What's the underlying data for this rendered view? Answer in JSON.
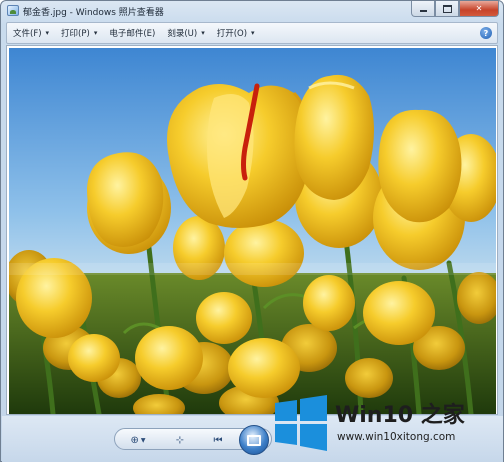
{
  "window": {
    "title": "郁金香.jpg - Windows 照片查看器"
  },
  "menubar": {
    "items": [
      {
        "label": "文件(F)",
        "caret": "▾"
      },
      {
        "label": "打印(P)",
        "caret": "▾"
      },
      {
        "label": "电子邮件(E)",
        "caret": ""
      },
      {
        "label": "刻录(U)",
        "caret": "▾"
      },
      {
        "label": "打开(O)",
        "caret": "▾"
      }
    ],
    "help_glyph": "?"
  },
  "photo": {
    "subject": "yellow tulips against a blue sky"
  },
  "controls": {
    "zoom_icon": "magnifier-icon",
    "fit_icon": "fit-window-icon",
    "prev_icon": "previous-icon",
    "slideshow_icon": "slideshow-icon"
  },
  "watermark": {
    "title": "Win10 之家",
    "url": "www.win10xitong.com"
  },
  "colors": {
    "sky": "#6fa9df",
    "tulip": "#f2c21c",
    "stem": "#3f6f1c",
    "accent_blue": "#1b8fdc"
  }
}
